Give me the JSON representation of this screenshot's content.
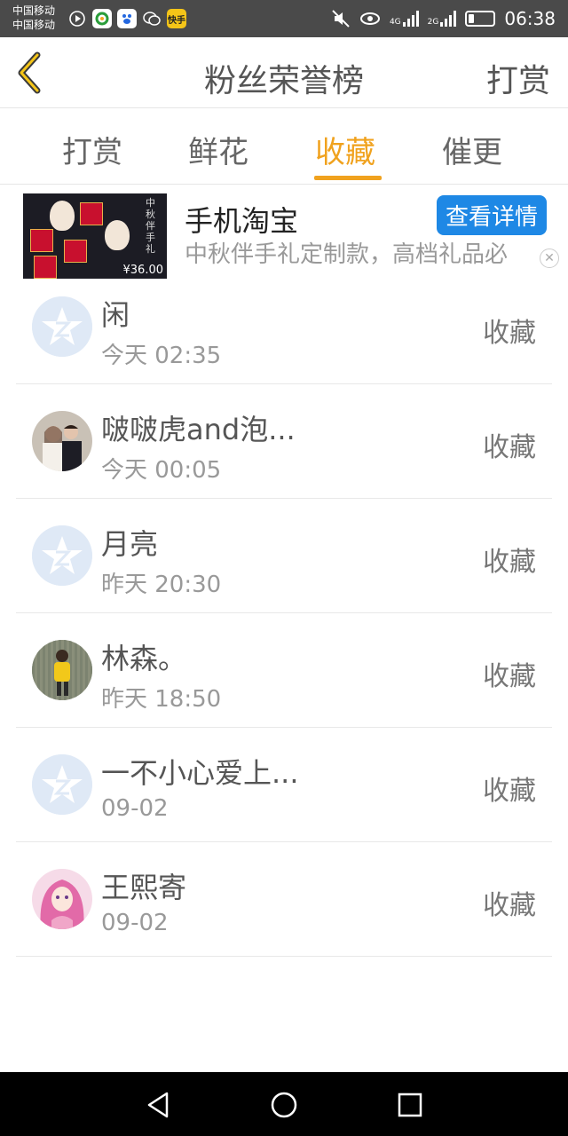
{
  "status_bar": {
    "carrier_1": "中国移动",
    "carrier_2": "中国移动",
    "net_1": "4G",
    "net_2": "2G",
    "time": "06:38",
    "app_badge": "快手"
  },
  "header": {
    "title": "粉丝荣誉榜",
    "right_action": "打赏"
  },
  "tabs": [
    {
      "label": "打赏",
      "active": false
    },
    {
      "label": "鲜花",
      "active": false
    },
    {
      "label": "收藏",
      "active": true
    },
    {
      "label": "催更",
      "active": false
    }
  ],
  "ad": {
    "title": "手机淘宝",
    "button": "查看详情",
    "description": "中秋伴手礼定制款，高档礼品必",
    "image_price": "¥36.00",
    "image_caption": "中秋伴手礼"
  },
  "list": [
    {
      "name": "闲",
      "time": "今天 02:35",
      "action": "收藏",
      "avatar": "default"
    },
    {
      "name": "啵啵虎and泡...",
      "time": "今天 00:05",
      "action": "收藏",
      "avatar": "couple-photo"
    },
    {
      "name": "月亮",
      "time": "昨天 20:30",
      "action": "收藏",
      "avatar": "default"
    },
    {
      "name": "林森。",
      "time": "昨天 18:50",
      "action": "收藏",
      "avatar": "person-photo"
    },
    {
      "name": "一不小心爱上...",
      "time": "09-02",
      "action": "收藏",
      "avatar": "default"
    },
    {
      "name": "王熙寄",
      "time": "09-02",
      "action": "收藏",
      "avatar": "anime-photo"
    }
  ],
  "colors": {
    "accent": "#f0a21e",
    "ad_button": "#1e88e5"
  }
}
